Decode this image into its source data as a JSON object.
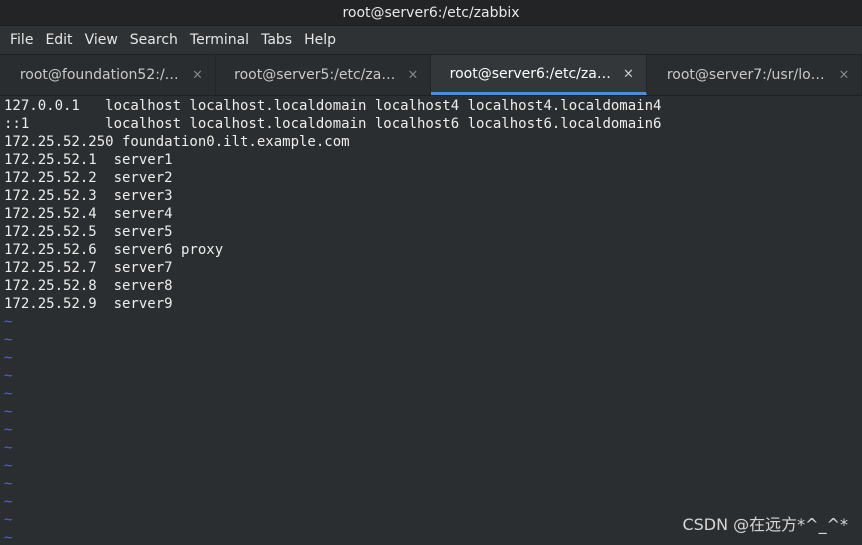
{
  "window": {
    "title": "root@server6:/etc/zabbix"
  },
  "menu": {
    "items": [
      {
        "label": "File"
      },
      {
        "label": "Edit"
      },
      {
        "label": "View"
      },
      {
        "label": "Search"
      },
      {
        "label": "Terminal"
      },
      {
        "label": "Tabs"
      },
      {
        "label": "Help"
      }
    ]
  },
  "tabs": [
    {
      "label": "root@foundation52:/…",
      "close": "×",
      "active": false
    },
    {
      "label": "root@server5:/etc/za…",
      "close": "×",
      "active": false
    },
    {
      "label": "root@server6:/etc/za…",
      "close": "×",
      "active": true
    },
    {
      "label": "root@server7:/usr/lo…",
      "close": "×",
      "active": false
    }
  ],
  "terminal": {
    "lines": [
      "127.0.0.1   localhost localhost.localdomain localhost4 localhost4.localdomain4",
      "::1         localhost localhost.localdomain localhost6 localhost6.localdomain6",
      "172.25.52.250 foundation0.ilt.example.com",
      "172.25.52.1  server1",
      "172.25.52.2  server2",
      "172.25.52.3  server3",
      "172.25.52.4  server4",
      "172.25.52.5  server5",
      "172.25.52.6  server6 proxy",
      "172.25.52.7  server7",
      "172.25.52.8  server8",
      "172.25.52.9  server9"
    ],
    "empty_marker": "~"
  },
  "watermark": "CSDN @在远方*^_^*",
  "colors": {
    "background": "#2b2e30",
    "text": "#ededed",
    "tilde": "#5a5fd0",
    "active_tab_accent": "#4a90d9"
  }
}
